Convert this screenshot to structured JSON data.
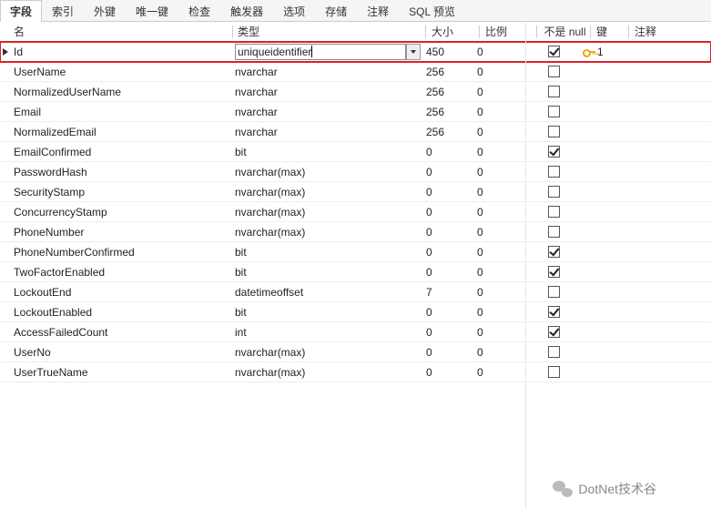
{
  "tabs": [
    "字段",
    "索引",
    "外键",
    "唯一键",
    "检查",
    "触发器",
    "选项",
    "存储",
    "注释",
    "SQL 预览"
  ],
  "activeTab": 0,
  "headers": {
    "name": "名",
    "type": "类型",
    "size": "大小",
    "scale": "比例",
    "notnull": "不是 null",
    "key": "键",
    "comment": "注释"
  },
  "rows": [
    {
      "name": "Id",
      "type": "uniqueidentifier",
      "size": "450",
      "scale": "0",
      "notnull": true,
      "key": "1",
      "selected": true,
      "editing": true
    },
    {
      "name": "UserName",
      "type": "nvarchar",
      "size": "256",
      "scale": "0",
      "notnull": false
    },
    {
      "name": "NormalizedUserName",
      "type": "nvarchar",
      "size": "256",
      "scale": "0",
      "notnull": false
    },
    {
      "name": "Email",
      "type": "nvarchar",
      "size": "256",
      "scale": "0",
      "notnull": false
    },
    {
      "name": "NormalizedEmail",
      "type": "nvarchar",
      "size": "256",
      "scale": "0",
      "notnull": false
    },
    {
      "name": "EmailConfirmed",
      "type": "bit",
      "size": "0",
      "scale": "0",
      "notnull": true
    },
    {
      "name": "PasswordHash",
      "type": "nvarchar(max)",
      "size": "0",
      "scale": "0",
      "notnull": false
    },
    {
      "name": "SecurityStamp",
      "type": "nvarchar(max)",
      "size": "0",
      "scale": "0",
      "notnull": false
    },
    {
      "name": "ConcurrencyStamp",
      "type": "nvarchar(max)",
      "size": "0",
      "scale": "0",
      "notnull": false
    },
    {
      "name": "PhoneNumber",
      "type": "nvarchar(max)",
      "size": "0",
      "scale": "0",
      "notnull": false
    },
    {
      "name": "PhoneNumberConfirmed",
      "type": "bit",
      "size": "0",
      "scale": "0",
      "notnull": true
    },
    {
      "name": "TwoFactorEnabled",
      "type": "bit",
      "size": "0",
      "scale": "0",
      "notnull": true
    },
    {
      "name": "LockoutEnd",
      "type": "datetimeoffset",
      "size": "7",
      "scale": "0",
      "notnull": false
    },
    {
      "name": "LockoutEnabled",
      "type": "bit",
      "size": "0",
      "scale": "0",
      "notnull": true
    },
    {
      "name": "AccessFailedCount",
      "type": "int",
      "size": "0",
      "scale": "0",
      "notnull": true
    },
    {
      "name": "UserNo",
      "type": "nvarchar(max)",
      "size": "0",
      "scale": "0",
      "notnull": false
    },
    {
      "name": "UserTrueName",
      "type": "nvarchar(max)",
      "size": "0",
      "scale": "0",
      "notnull": false
    }
  ],
  "footer": "DotNet技术谷"
}
